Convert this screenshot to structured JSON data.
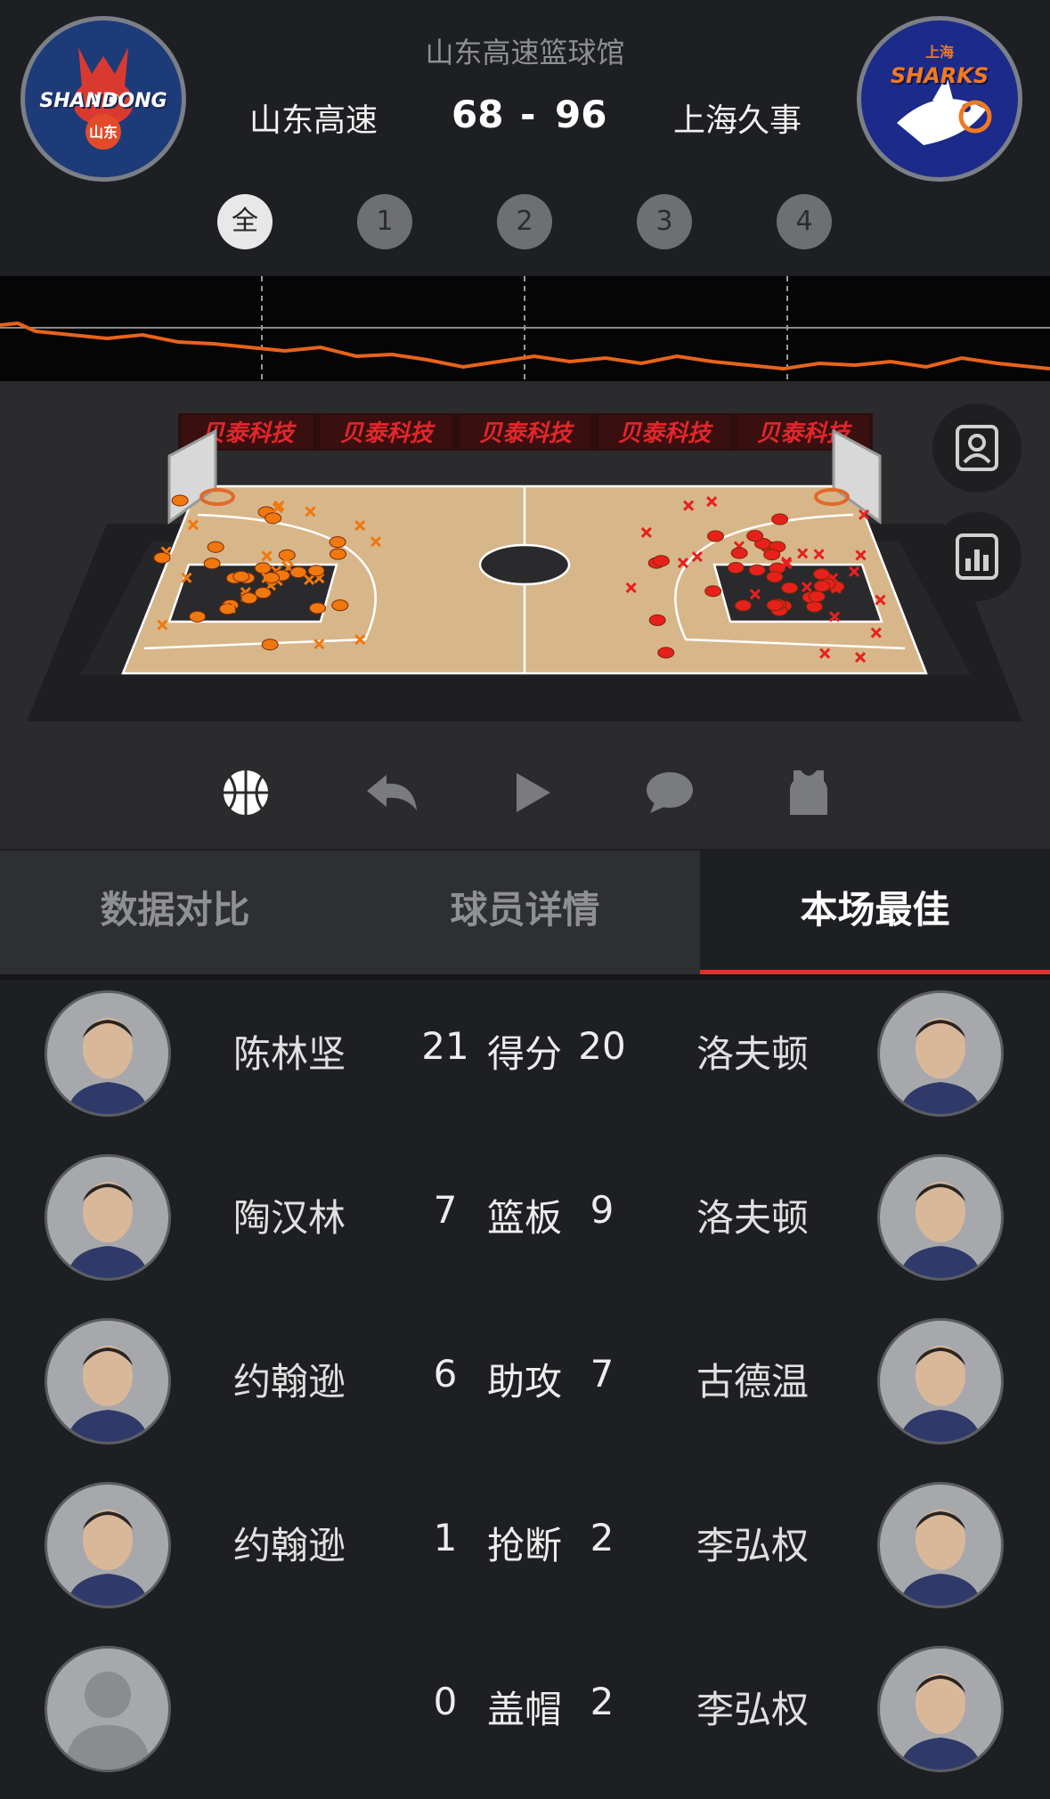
{
  "header": {
    "venue": "山东高速篮球馆",
    "home": {
      "name": "山东高速",
      "score": "68",
      "logo_text": "SHANDONG",
      "logo_sub": "山东",
      "logo_color": "#1d3b78"
    },
    "away": {
      "name": "上海久事",
      "score": "96",
      "logo_text": "SHARKS",
      "logo_sub": "上海",
      "logo_color": "#1c2a8a"
    },
    "score_sep": "-",
    "periods": [
      {
        "label": "全",
        "active": true
      },
      {
        "label": "1",
        "active": false
      },
      {
        "label": "2",
        "active": false
      },
      {
        "label": "3",
        "active": false
      },
      {
        "label": "4",
        "active": false
      }
    ]
  },
  "trend": {
    "line_color": "#e8631c"
  },
  "court": {
    "sponsor_text": "贝泰科技",
    "home_shot_color": "#f0780f",
    "away_shot_color": "#e8201c",
    "side_buttons": [
      {
        "icon": "player-card-icon"
      },
      {
        "icon": "stats-chart-icon"
      }
    ]
  },
  "toolbar": [
    {
      "icon": "basketball-icon",
      "active": true
    },
    {
      "icon": "rewind-icon",
      "active": false
    },
    {
      "icon": "play-icon",
      "active": false
    },
    {
      "icon": "comment-icon",
      "active": false
    },
    {
      "icon": "jersey-icon",
      "active": false
    }
  ],
  "tabs": [
    {
      "label": "数据对比",
      "active": false
    },
    {
      "label": "球员详情",
      "active": false
    },
    {
      "label": "本场最佳",
      "active": true
    }
  ],
  "accent": "#e2302e",
  "best": [
    {
      "left_name": "陈林坚",
      "left_value": "21",
      "stat": "得分",
      "right_value": "20",
      "right_name": "洛夫顿"
    },
    {
      "left_name": "陶汉林",
      "left_value": "7",
      "stat": "篮板",
      "right_value": "9",
      "right_name": "洛夫顿"
    },
    {
      "left_name": "约翰逊",
      "left_value": "6",
      "stat": "助攻",
      "right_value": "7",
      "right_name": "古德温"
    },
    {
      "left_name": "约翰逊",
      "left_value": "1",
      "stat": "抢断",
      "right_value": "2",
      "right_name": "李弘权"
    },
    {
      "left_name": "",
      "left_value": "0",
      "stat": "盖帽",
      "right_value": "2",
      "right_name": "李弘权"
    }
  ]
}
